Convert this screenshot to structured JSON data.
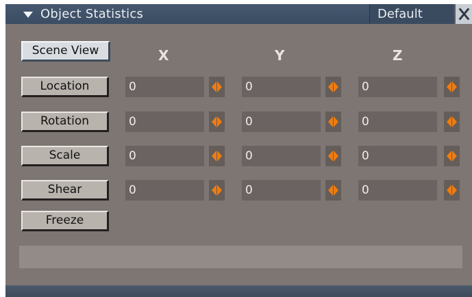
{
  "window": {
    "title": "Object Statistics",
    "preset": "Default"
  },
  "buttons": {
    "scene_view": "Scene View",
    "location": "Location",
    "rotation": "Rotation",
    "scale": "Scale",
    "shear": "Shear",
    "freeze": "Freeze"
  },
  "axes": [
    "X",
    "Y",
    "Z"
  ],
  "rows": [
    {
      "name": "location",
      "values": [
        "0",
        "0",
        "0"
      ]
    },
    {
      "name": "rotation",
      "values": [
        "0",
        "0",
        "0"
      ]
    },
    {
      "name": "scale",
      "values": [
        "0",
        "0",
        "0"
      ]
    },
    {
      "name": "shear",
      "values": [
        "0",
        "0",
        "0"
      ]
    }
  ],
  "status": "",
  "colors": {
    "spinner_accent": "#f07c10",
    "panel": "#7d7673",
    "titlebar": "#45586f"
  },
  "icons": {
    "collapse": "triangle-down-icon",
    "close": "close-icon",
    "spinner": "left-right-arrows-icon"
  }
}
